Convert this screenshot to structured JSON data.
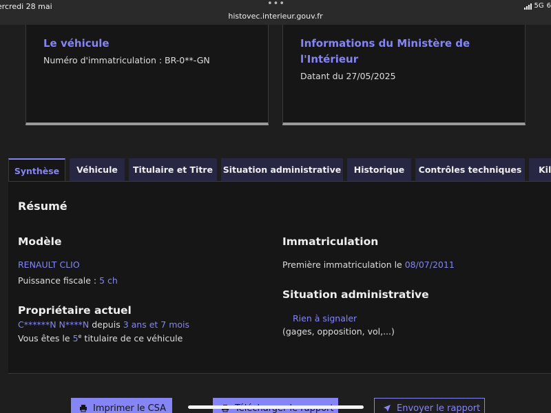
{
  "statusbar": {
    "date": "ercredi 28 mai",
    "dots": "•••",
    "url": "histovec.interieur.gouv.fr",
    "network": "5G",
    "battery": "6"
  },
  "cards": {
    "vehicle": {
      "title": "Le véhicule",
      "plate": "Numéro d'immatriculation : BR-0**-GN"
    },
    "ministry": {
      "title": "Informations du Ministère de l'Intérieur",
      "date": "Datant du 27/05/2025"
    }
  },
  "tabs": [
    {
      "label": "Synthèse"
    },
    {
      "label": "Véhicule"
    },
    {
      "label": "Titulaire et Titre"
    },
    {
      "label": "Situation administrative"
    },
    {
      "label": "Historique"
    },
    {
      "label": "Contrôles techniques"
    },
    {
      "label": "Kilo"
    }
  ],
  "summary": {
    "title": "Résumé",
    "model": {
      "heading": "Modèle",
      "name": "RENAULT CLIO",
      "power_label": "Puissance fiscale :",
      "power_value": "5 ch"
    },
    "owner": {
      "heading": "Propriétaire actuel",
      "name": "C******N N****N",
      "since_label": "depuis",
      "since_value": "3 ans et 7 mois",
      "rank_prefix": "Vous êtes le",
      "rank_number": "5",
      "rank_suffix_sup": "e",
      "rank_suffix": "titulaire de ce véhicule"
    },
    "registration": {
      "heading": "Immatriculation",
      "first_label": "Première immatriculation le",
      "first_date": "08/07/2011"
    },
    "admin": {
      "heading": "Situation administrative",
      "status": "Rien à signaler",
      "details": "(gages, opposition, vol,...)"
    }
  },
  "actions": {
    "print": "Imprimer le CSA",
    "download": "Télécharger le rapport",
    "send": "Envoyer le rapport"
  },
  "colors": {
    "accent": "#8585f6",
    "background": "#1e1e1e",
    "panel": "#161616",
    "tab": "#272744"
  }
}
